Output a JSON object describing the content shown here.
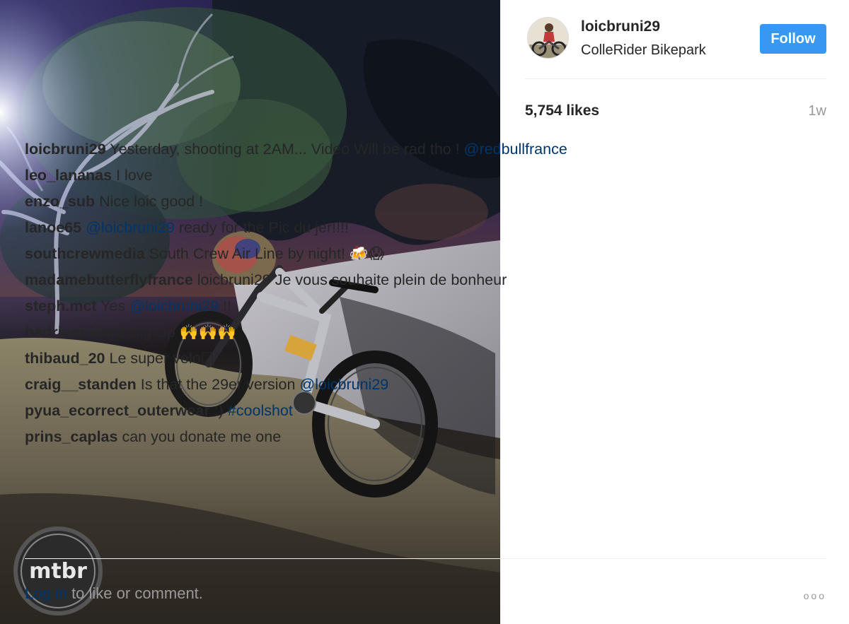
{
  "post": {
    "username": "loicbruni29",
    "location": "ColleRider Bikepark",
    "follow_label": "Follow",
    "likes": "5,754 likes",
    "timestamp": "1w",
    "watermark": "mtbr"
  },
  "comments": [
    {
      "user": "loicbruni29",
      "text": "Yesterday, shooting at 2AM... Video Will be rad tho !",
      "mention": "@redbullfrance",
      "after": ""
    },
    {
      "user": "leo_lananas",
      "text": "I love",
      "mention": "",
      "after": ""
    },
    {
      "user": "enzo_sub",
      "text": "Nice loic good !",
      "mention": "",
      "after": ""
    },
    {
      "user": "lanoe65",
      "text": "",
      "mention": "@loicbruni29",
      "after": "ready for the Pic du jer!!!!"
    },
    {
      "user": "southcrewmedia",
      "text": "South Crew Air Line by night! 🍻😱",
      "mention": "",
      "after": ""
    },
    {
      "user": "madamebutterflyfrance",
      "text": "loicbruni29 Je vous souhaite plein de bonheur",
      "mention": "",
      "after": ""
    },
    {
      "user": "steph.mct",
      "text": "Yes",
      "mention": "@loicbruni29",
      "after": "!!"
    },
    {
      "user": "hadrienpicard",
      "text": "Big Up 🙌🙌🙌",
      "mention": "",
      "after": ""
    },
    {
      "user": "thibaud_20",
      "text": "Le super velo☐",
      "mention": "",
      "after": ""
    },
    {
      "user": "craig__standen",
      "text": "Is that the 29er version",
      "mention": "@loicbruni29",
      "after": ""
    },
    {
      "user": "pyua_ecorrect_outerwear",
      "text": ":)",
      "mention": "#coolshot",
      "after": ""
    },
    {
      "user": "prins_caplas",
      "text": "can you donate me one",
      "mention": "",
      "after": ""
    }
  ],
  "footer": {
    "login_link": "Log in",
    "login_text": " to like or comment.",
    "more_icon": "ooo"
  }
}
